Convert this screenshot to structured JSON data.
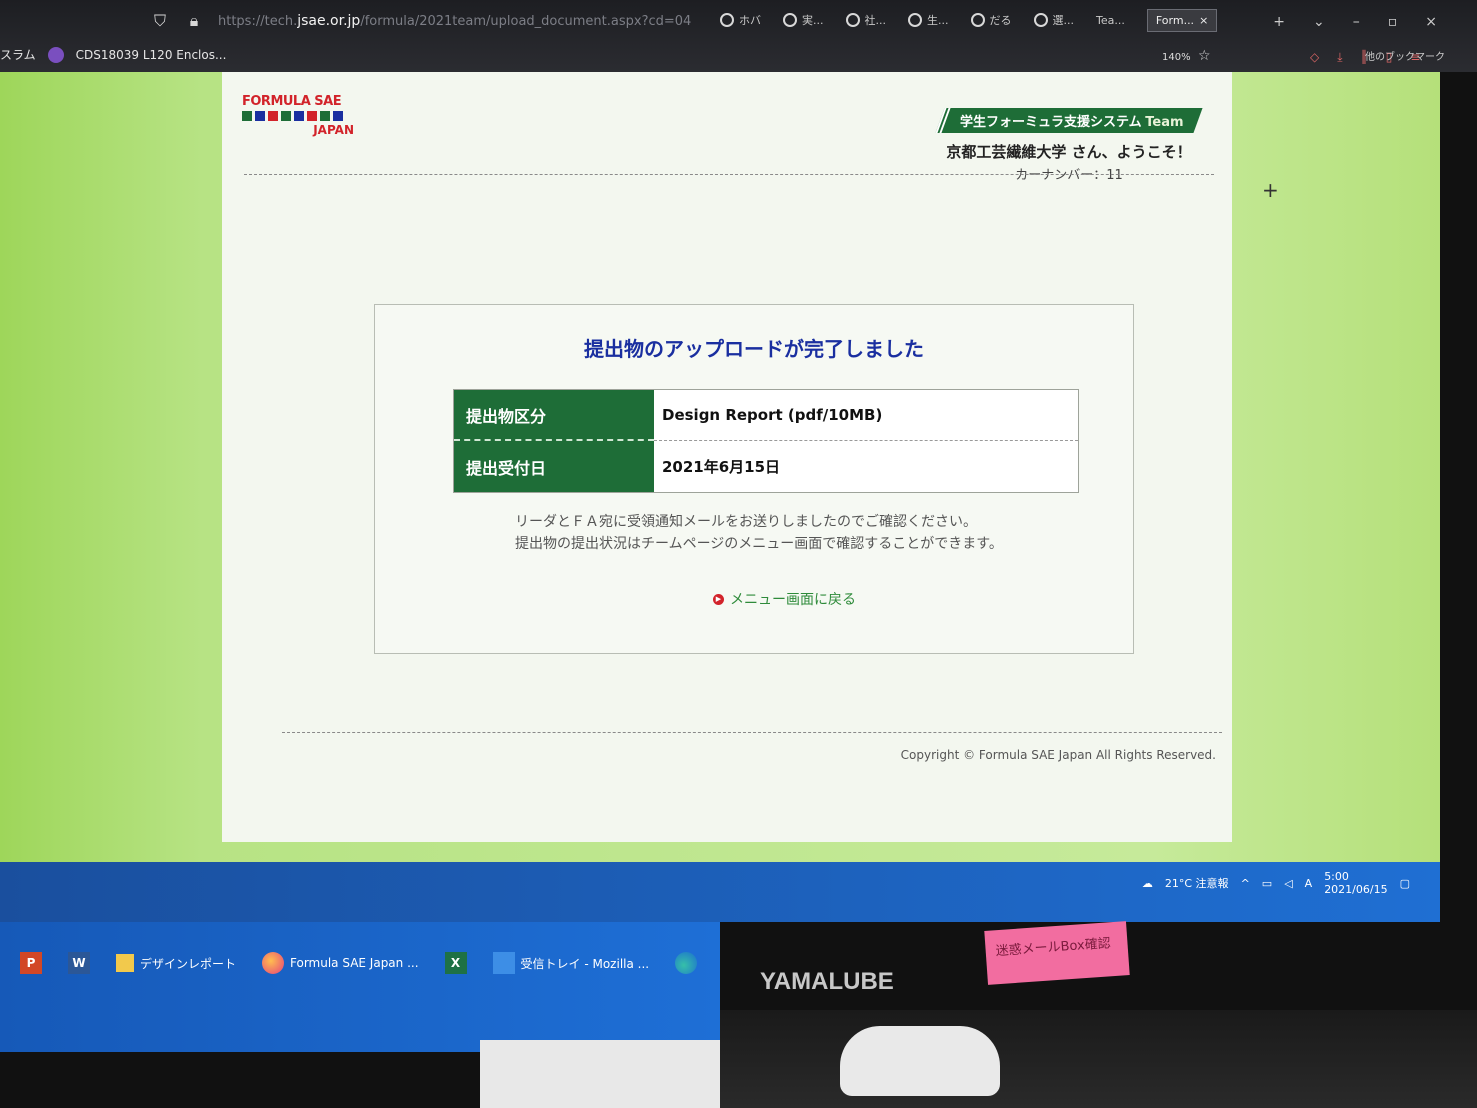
{
  "browser": {
    "url_prefix": "https://tech.",
    "url_host": "jsae.or.jp",
    "url_path": "/formula/2021team/upload_document.aspx?cd=04",
    "tabs": [
      "ホバ",
      "実...",
      "社...",
      "生...",
      "だる",
      "選...",
      "Tea...",
      "Form..."
    ],
    "active_tab_close": "×",
    "window_controls": [
      "+",
      "⌄",
      "–",
      "▫",
      "×"
    ],
    "bookmark_left_1": "スラム",
    "bookmark_left_2": "CDS18039 L120 Enclos...",
    "zoom": "140%",
    "other_bookmarks": "他のブックマーク"
  },
  "header": {
    "logo_top": "FORMULA SAE",
    "logo_bottom": "JAPAN",
    "system_banner": "学生フォーミュラ支援システム",
    "banner_team": "Team",
    "welcome": "京都工芸繊維大学 さん、ようこそ！",
    "car_number": "カーナンバー：11"
  },
  "panel": {
    "title": "提出物のアップロードが完了しました",
    "rows": [
      {
        "label": "提出物区分",
        "value": "Design Report (pdf/10MB)"
      },
      {
        "label": "提出受付日",
        "value": "2021年6月15日"
      }
    ],
    "notice_line1": "リーダとＦＡ宛に受領通知メールをお送りしましたのでご確認ください。",
    "notice_line2": "提出物の提出状況はチームページのメニュー画面で確認することができます。",
    "back_link": "メニュー画面に戻る"
  },
  "footer": {
    "copyright": "Copyright © Formula SAE Japan All Rights Reserved."
  },
  "taskbar": {
    "items": [
      {
        "label": "デザインレポート"
      },
      {
        "label": "Formula SAE Japan ..."
      },
      {
        "label": "受信トレイ - Mozilla ..."
      }
    ],
    "weather": "21°C 注意報",
    "time": "5:00",
    "date": "2021/06/15"
  },
  "desk": {
    "monitor_brand": "YAMALUBE",
    "sticky_note": "迷惑メールBox確認"
  },
  "colors": {
    "green_header": "#1e6d37",
    "title_blue": "#1a2fa0",
    "link_green": "#2e8b3a",
    "page_green": "#b7e384"
  }
}
